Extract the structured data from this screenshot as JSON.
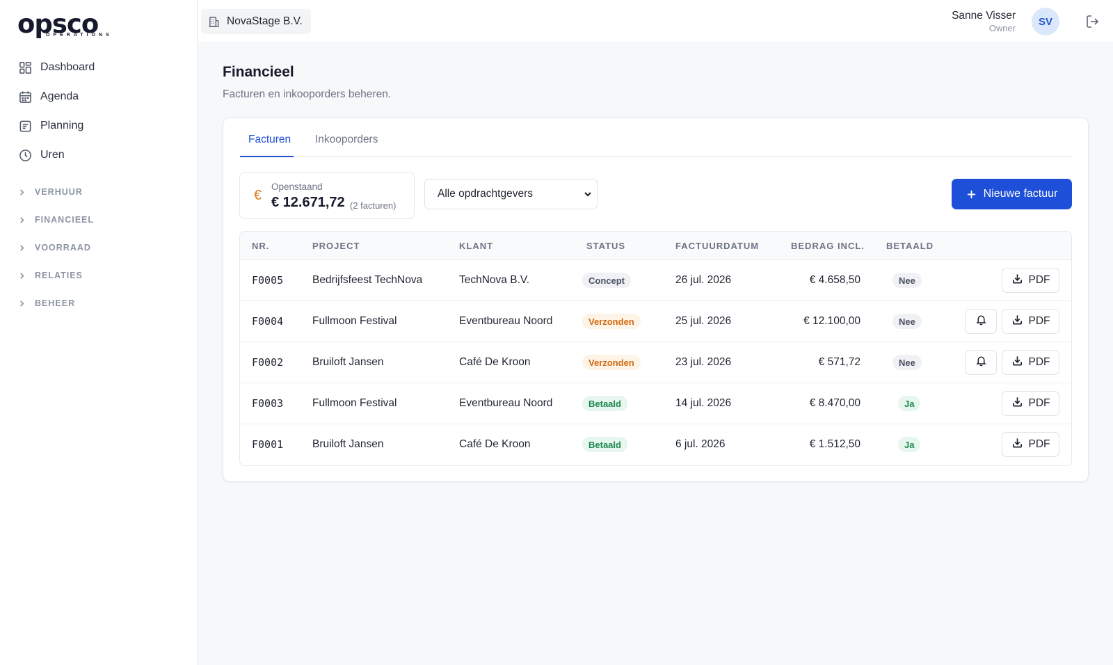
{
  "brand": {
    "logo_text": "opsco",
    "logo_sub": "OPERATIONS",
    "accent": "#1d4fd8"
  },
  "sidebar": {
    "items": [
      {
        "label": "Dashboard",
        "icon": "dashboard-icon"
      },
      {
        "label": "Agenda",
        "icon": "calendar-icon"
      },
      {
        "label": "Planning",
        "icon": "planning-icon"
      },
      {
        "label": "Uren",
        "icon": "clock-icon"
      }
    ],
    "groups": [
      {
        "label": "VERHUUR"
      },
      {
        "label": "FINANCIEEL"
      },
      {
        "label": "VOORRAAD"
      },
      {
        "label": "RELATIES"
      },
      {
        "label": "BEHEER"
      }
    ]
  },
  "topbar": {
    "org_name": "NovaStage B.V.",
    "user_name": "Sanne Visser",
    "user_role": "Owner",
    "avatar_initials": "SV"
  },
  "page": {
    "title": "Financieel",
    "subtitle": "Facturen en inkooporders beheren."
  },
  "tabs": [
    {
      "label": "Facturen",
      "active": true
    },
    {
      "label": "Inkooporders",
      "active": false
    }
  ],
  "summary": {
    "symbol": "€",
    "label": "Openstaand",
    "amount": "€ 12.671,72",
    "count": "(2 facturen)"
  },
  "filter": {
    "selected": "Alle opdrachtgevers"
  },
  "new_button": {
    "label": "Nieuwe factuur"
  },
  "table": {
    "headers": [
      "NR.",
      "PROJECT",
      "KLANT",
      "STATUS",
      "FACTUURDATUM",
      "BEDRAG INCL.",
      "BETAALD"
    ],
    "pdf_label": "PDF",
    "rows": [
      {
        "nr": "F0005",
        "project": "Bedrijfsfeest TechNova",
        "client": "TechNova B.V.",
        "status": "Concept",
        "status_type": "concept",
        "date": "26 jul. 2026",
        "amount": "€ 4.658,50",
        "paid": "Nee",
        "reminder": false
      },
      {
        "nr": "F0004",
        "project": "Fullmoon Festival",
        "client": "Eventbureau Noord",
        "status": "Verzonden",
        "status_type": "sent",
        "date": "25 jul. 2026",
        "amount": "€ 12.100,00",
        "paid": "Nee",
        "reminder": true
      },
      {
        "nr": "F0002",
        "project": "Bruiloft Jansen",
        "client": "Café De Kroon",
        "status": "Verzonden",
        "status_type": "sent",
        "date": "23 jul. 2026",
        "amount": "€ 571,72",
        "paid": "Nee",
        "reminder": true
      },
      {
        "nr": "F0003",
        "project": "Fullmoon Festival",
        "client": "Eventbureau Noord",
        "status": "Betaald",
        "status_type": "paid",
        "date": "14 jul. 2026",
        "amount": "€ 8.470,00",
        "paid": "Ja",
        "reminder": false
      },
      {
        "nr": "F0001",
        "project": "Bruiloft Jansen",
        "client": "Café De Kroon",
        "status": "Betaald",
        "status_type": "paid",
        "date": "6 jul. 2026",
        "amount": "€ 1.512,50",
        "paid": "Ja",
        "reminder": false
      }
    ]
  }
}
